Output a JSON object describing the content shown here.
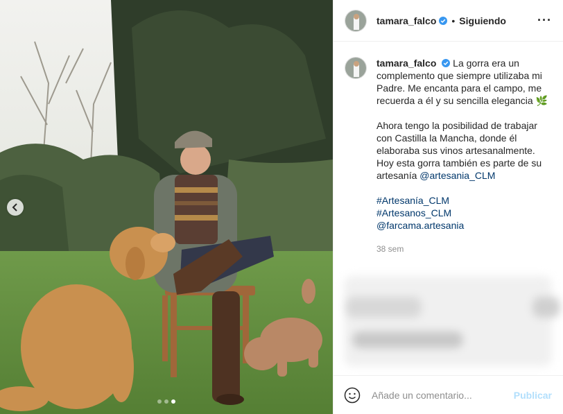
{
  "post": {
    "username": "tamara_falco",
    "follow_status": "Siguiendo",
    "separator": "•",
    "more_label": "···",
    "caption_lines": [
      "La gorra era un complemento que siempre utilizaba mi Padre. Me encanta para el campo, me recuerda a él y su sencilla elegancia 🌿",
      "Ahora tengo la posibilidad de trabajar con Castilla la Mancha, donde él elaboraba sus vinos artesanalmente. Hoy esta gorra también es parte de su artesanía "
    ],
    "caption_mention": "@artesania_CLM",
    "tags": [
      "#Artesanía_CLM",
      "#Artesanos_CLM",
      "@farcama.artesania"
    ],
    "time": "38 sem"
  },
  "carousel": {
    "total": 3,
    "active": 3
  },
  "comment_box": {
    "placeholder": "Añade un comentario...",
    "publish_label": "Publicar"
  },
  "colors": {
    "verified": "#3897f0",
    "link": "#00376b",
    "publish_disabled": "#b2dffc"
  }
}
